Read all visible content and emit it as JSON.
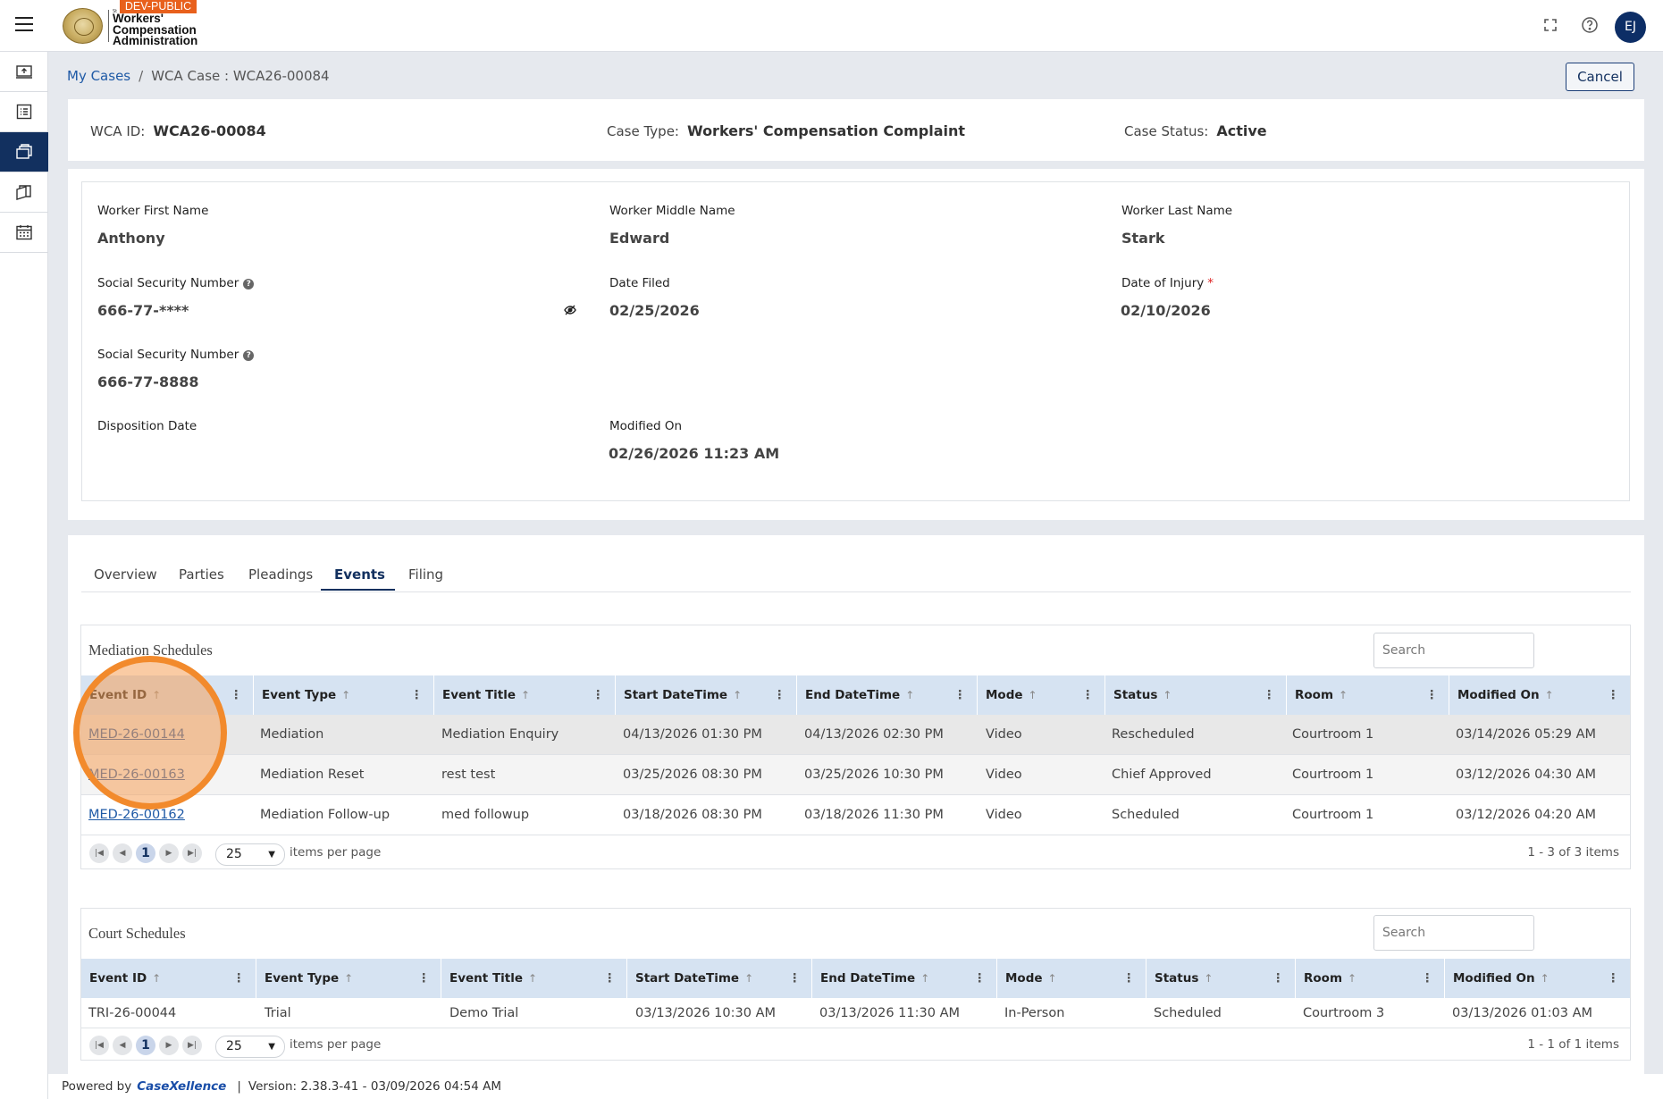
{
  "header": {
    "env_badge": "DEV-PUBLIC",
    "logo_small": "St",
    "logo_line1": "Workers'",
    "logo_line2": "Compensation",
    "logo_line3": "Administration",
    "avatar_initials": "EJ"
  },
  "sidebar": {
    "items": [
      {
        "name": "upload-icon"
      },
      {
        "name": "list-icon"
      },
      {
        "name": "briefcase-icon",
        "active": true
      },
      {
        "name": "documents-icon"
      },
      {
        "name": "calendar-icon"
      }
    ]
  },
  "breadcrumb": {
    "root": "My Cases",
    "separator": "/",
    "current": "WCA Case : WCA26-00084"
  },
  "actions": {
    "cancel_label": "Cancel"
  },
  "summary": {
    "wca_id_label": "WCA ID:",
    "wca_id": "WCA26-00084",
    "case_type_label": "Case Type:",
    "case_type": "Workers' Compensation Complaint",
    "case_status_label": "Case Status:",
    "case_status": "Active"
  },
  "details": {
    "first_name_label": "Worker First Name",
    "first_name": "Anthony",
    "middle_name_label": "Worker Middle Name",
    "middle_name": "Edward",
    "last_name_label": "Worker Last Name",
    "last_name": "Stark",
    "ssn_label": "Social Security Number",
    "ssn_masked": "666-77-****",
    "date_filed_label": "Date Filed",
    "date_filed": "02/25/2026",
    "date_injury_label": "Date of Injury",
    "date_injury": "02/10/2026",
    "ssn2_label": "Social Security Number",
    "ssn_full": "666-77-8888",
    "disposition_label": "Disposition Date",
    "disposition": "",
    "modified_label": "Modified On",
    "modified": "02/26/2026 11:23 AM"
  },
  "tabs": [
    "Overview",
    "Parties",
    "Pleadings",
    "Events",
    "Filing"
  ],
  "active_tab": "Events",
  "mediation": {
    "title": "Mediation Schedules",
    "search_placeholder": "Search",
    "columns": [
      "Event ID",
      "Event Type",
      "Event Title",
      "Start DateTime",
      "End DateTime",
      "Mode",
      "Status",
      "Room",
      "Modified On"
    ],
    "rows": [
      [
        "MED-26-00144",
        "Mediation",
        "Mediation Enquiry",
        "04/13/2026 01:30 PM",
        "04/13/2026 02:30 PM",
        "Video",
        "Rescheduled",
        "Courtroom 1",
        "03/14/2026 05:29 AM"
      ],
      [
        "MED-26-00163",
        "Mediation Reset",
        "rest test",
        "03/25/2026 08:30 PM",
        "03/25/2026 10:30 PM",
        "Video",
        "Chief Approved",
        "Courtroom 1",
        "03/12/2026 04:30 AM"
      ],
      [
        "MED-26-00162",
        "Mediation Follow-up",
        "med followup",
        "03/18/2026 08:30 PM",
        "03/18/2026 11:30 PM",
        "Video",
        "Scheduled",
        "Courtroom 1",
        "03/12/2026 04:20 AM"
      ]
    ],
    "page": "1",
    "page_size": "25",
    "items_per_page": "items per page",
    "info": "1 - 3 of 3 items"
  },
  "court": {
    "title": "Court Schedules",
    "search_placeholder": "Search",
    "columns": [
      "Event ID",
      "Event Type",
      "Event Title",
      "Start DateTime",
      "End DateTime",
      "Mode",
      "Status",
      "Room",
      "Modified On"
    ],
    "rows": [
      [
        "TRI-26-00044",
        "Trial",
        "Demo Trial",
        "03/13/2026 10:30 AM",
        "03/13/2026 11:30 AM",
        "In-Person",
        "Scheduled",
        "Courtroom 3",
        "03/13/2026 01:03 AM"
      ]
    ],
    "page": "1",
    "page_size": "25",
    "items_per_page": "items per page",
    "info": "1 - 1 of 1 items"
  },
  "footer": {
    "powered_by": "Powered by",
    "brand": "CaseXellence",
    "separator": "|",
    "version": "Version: 2.38.3-41 - 03/09/2026 04:54 AM"
  }
}
